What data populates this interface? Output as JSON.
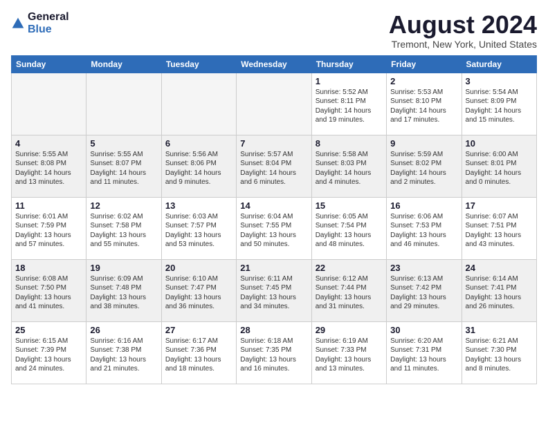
{
  "logo": {
    "general": "General",
    "blue": "Blue"
  },
  "title": "August 2024",
  "location": "Tremont, New York, United States",
  "weekdays": [
    "Sunday",
    "Monday",
    "Tuesday",
    "Wednesday",
    "Thursday",
    "Friday",
    "Saturday"
  ],
  "weeks": [
    [
      {
        "day": "",
        "info": ""
      },
      {
        "day": "",
        "info": ""
      },
      {
        "day": "",
        "info": ""
      },
      {
        "day": "",
        "info": ""
      },
      {
        "day": "1",
        "info": "Sunrise: 5:52 AM\nSunset: 8:11 PM\nDaylight: 14 hours\nand 19 minutes."
      },
      {
        "day": "2",
        "info": "Sunrise: 5:53 AM\nSunset: 8:10 PM\nDaylight: 14 hours\nand 17 minutes."
      },
      {
        "day": "3",
        "info": "Sunrise: 5:54 AM\nSunset: 8:09 PM\nDaylight: 14 hours\nand 15 minutes."
      }
    ],
    [
      {
        "day": "4",
        "info": "Sunrise: 5:55 AM\nSunset: 8:08 PM\nDaylight: 14 hours\nand 13 minutes."
      },
      {
        "day": "5",
        "info": "Sunrise: 5:55 AM\nSunset: 8:07 PM\nDaylight: 14 hours\nand 11 minutes."
      },
      {
        "day": "6",
        "info": "Sunrise: 5:56 AM\nSunset: 8:06 PM\nDaylight: 14 hours\nand 9 minutes."
      },
      {
        "day": "7",
        "info": "Sunrise: 5:57 AM\nSunset: 8:04 PM\nDaylight: 14 hours\nand 6 minutes."
      },
      {
        "day": "8",
        "info": "Sunrise: 5:58 AM\nSunset: 8:03 PM\nDaylight: 14 hours\nand 4 minutes."
      },
      {
        "day": "9",
        "info": "Sunrise: 5:59 AM\nSunset: 8:02 PM\nDaylight: 14 hours\nand 2 minutes."
      },
      {
        "day": "10",
        "info": "Sunrise: 6:00 AM\nSunset: 8:01 PM\nDaylight: 14 hours\nand 0 minutes."
      }
    ],
    [
      {
        "day": "11",
        "info": "Sunrise: 6:01 AM\nSunset: 7:59 PM\nDaylight: 13 hours\nand 57 minutes."
      },
      {
        "day": "12",
        "info": "Sunrise: 6:02 AM\nSunset: 7:58 PM\nDaylight: 13 hours\nand 55 minutes."
      },
      {
        "day": "13",
        "info": "Sunrise: 6:03 AM\nSunset: 7:57 PM\nDaylight: 13 hours\nand 53 minutes."
      },
      {
        "day": "14",
        "info": "Sunrise: 6:04 AM\nSunset: 7:55 PM\nDaylight: 13 hours\nand 50 minutes."
      },
      {
        "day": "15",
        "info": "Sunrise: 6:05 AM\nSunset: 7:54 PM\nDaylight: 13 hours\nand 48 minutes."
      },
      {
        "day": "16",
        "info": "Sunrise: 6:06 AM\nSunset: 7:53 PM\nDaylight: 13 hours\nand 46 minutes."
      },
      {
        "day": "17",
        "info": "Sunrise: 6:07 AM\nSunset: 7:51 PM\nDaylight: 13 hours\nand 43 minutes."
      }
    ],
    [
      {
        "day": "18",
        "info": "Sunrise: 6:08 AM\nSunset: 7:50 PM\nDaylight: 13 hours\nand 41 minutes."
      },
      {
        "day": "19",
        "info": "Sunrise: 6:09 AM\nSunset: 7:48 PM\nDaylight: 13 hours\nand 38 minutes."
      },
      {
        "day": "20",
        "info": "Sunrise: 6:10 AM\nSunset: 7:47 PM\nDaylight: 13 hours\nand 36 minutes."
      },
      {
        "day": "21",
        "info": "Sunrise: 6:11 AM\nSunset: 7:45 PM\nDaylight: 13 hours\nand 34 minutes."
      },
      {
        "day": "22",
        "info": "Sunrise: 6:12 AM\nSunset: 7:44 PM\nDaylight: 13 hours\nand 31 minutes."
      },
      {
        "day": "23",
        "info": "Sunrise: 6:13 AM\nSunset: 7:42 PM\nDaylight: 13 hours\nand 29 minutes."
      },
      {
        "day": "24",
        "info": "Sunrise: 6:14 AM\nSunset: 7:41 PM\nDaylight: 13 hours\nand 26 minutes."
      }
    ],
    [
      {
        "day": "25",
        "info": "Sunrise: 6:15 AM\nSunset: 7:39 PM\nDaylight: 13 hours\nand 24 minutes."
      },
      {
        "day": "26",
        "info": "Sunrise: 6:16 AM\nSunset: 7:38 PM\nDaylight: 13 hours\nand 21 minutes."
      },
      {
        "day": "27",
        "info": "Sunrise: 6:17 AM\nSunset: 7:36 PM\nDaylight: 13 hours\nand 18 minutes."
      },
      {
        "day": "28",
        "info": "Sunrise: 6:18 AM\nSunset: 7:35 PM\nDaylight: 13 hours\nand 16 minutes."
      },
      {
        "day": "29",
        "info": "Sunrise: 6:19 AM\nSunset: 7:33 PM\nDaylight: 13 hours\nand 13 minutes."
      },
      {
        "day": "30",
        "info": "Sunrise: 6:20 AM\nSunset: 7:31 PM\nDaylight: 13 hours\nand 11 minutes."
      },
      {
        "day": "31",
        "info": "Sunrise: 6:21 AM\nSunset: 7:30 PM\nDaylight: 13 hours\nand 8 minutes."
      }
    ]
  ]
}
